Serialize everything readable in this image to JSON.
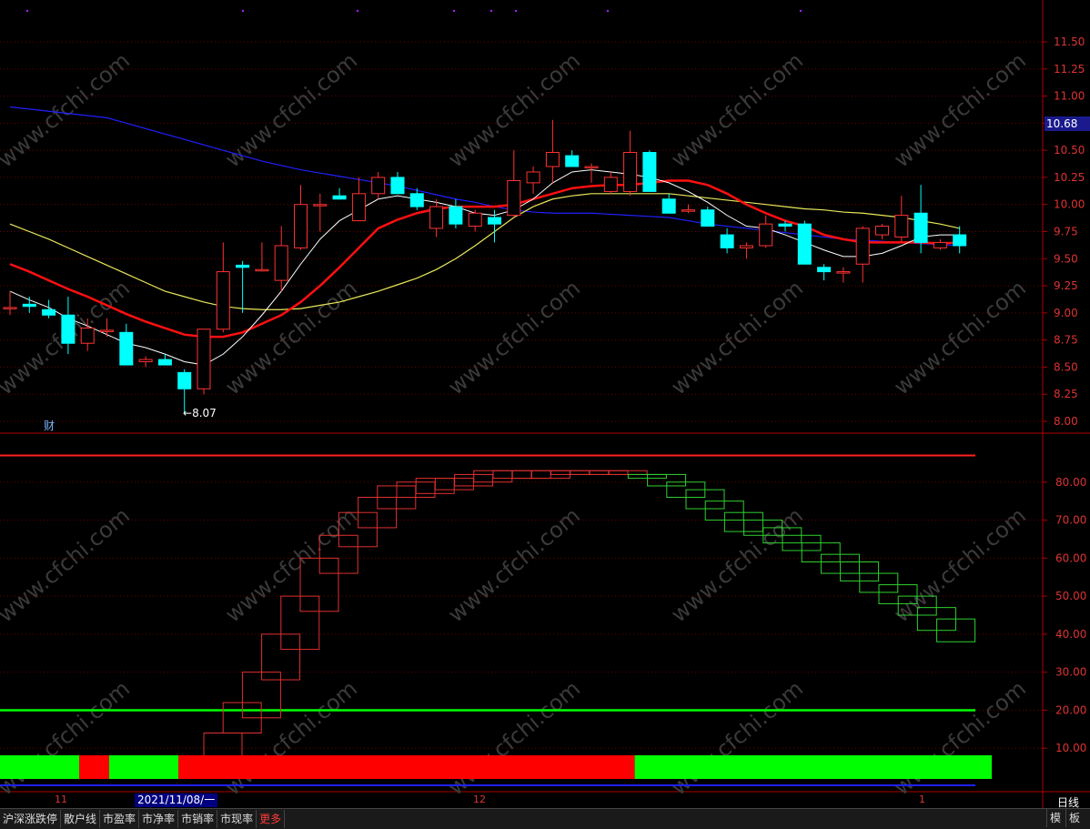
{
  "chart_data": [
    {
      "type": "candlestick",
      "y_ticks": [
        "11.50",
        "11.25",
        "11.00",
        "10.75",
        "10.50",
        "10.25",
        "10.00",
        "9.75",
        "9.50",
        "9.25",
        "9.00",
        "8.75",
        "8.50",
        "8.25",
        "8.00"
      ],
      "ylim": [
        8.0,
        11.5
      ],
      "current_price": "10.68",
      "low_annotation": "8.07",
      "finance_marker": "财",
      "candles": [
        {
          "o": 9.05,
          "h": 9.2,
          "l": 8.98,
          "c": 9.05
        },
        {
          "o": 9.08,
          "h": 9.15,
          "l": 9.0,
          "c": 9.06
        },
        {
          "o": 9.03,
          "h": 9.12,
          "l": 8.95,
          "c": 8.98
        },
        {
          "o": 8.98,
          "h": 9.15,
          "l": 8.62,
          "c": 8.72
        },
        {
          "o": 8.72,
          "h": 8.95,
          "l": 8.65,
          "c": 8.86
        },
        {
          "o": 8.84,
          "h": 8.95,
          "l": 8.78,
          "c": 8.84
        },
        {
          "o": 8.82,
          "h": 8.9,
          "l": 8.52,
          "c": 8.52
        },
        {
          "o": 8.55,
          "h": 8.6,
          "l": 8.5,
          "c": 8.57
        },
        {
          "o": 8.57,
          "h": 8.62,
          "l": 8.52,
          "c": 8.52
        },
        {
          "o": 8.45,
          "h": 8.48,
          "l": 8.07,
          "c": 8.3
        },
        {
          "o": 8.3,
          "h": 8.85,
          "l": 8.25,
          "c": 8.85
        },
        {
          "o": 8.85,
          "h": 9.65,
          "l": 8.82,
          "c": 9.38
        },
        {
          "o": 9.44,
          "h": 9.48,
          "l": 9.0,
          "c": 9.42
        },
        {
          "o": 9.4,
          "h": 9.65,
          "l": 9.38,
          "c": 9.4
        },
        {
          "o": 9.3,
          "h": 9.8,
          "l": 9.2,
          "c": 9.62
        },
        {
          "o": 9.6,
          "h": 10.18,
          "l": 9.58,
          "c": 10.0
        },
        {
          "o": 10.0,
          "h": 10.1,
          "l": 9.75,
          "c": 10.0
        },
        {
          "o": 10.08,
          "h": 10.15,
          "l": 10.05,
          "c": 10.05
        },
        {
          "o": 9.85,
          "h": 10.25,
          "l": 9.85,
          "c": 10.1
        },
        {
          "o": 10.1,
          "h": 10.3,
          "l": 10.05,
          "c": 10.25
        },
        {
          "o": 10.25,
          "h": 10.3,
          "l": 10.1,
          "c": 10.1
        },
        {
          "o": 10.1,
          "h": 10.15,
          "l": 9.95,
          "c": 9.98
        },
        {
          "o": 9.78,
          "h": 10.05,
          "l": 9.7,
          "c": 9.98
        },
        {
          "o": 9.98,
          "h": 10.05,
          "l": 9.78,
          "c": 9.82
        },
        {
          "o": 9.8,
          "h": 9.95,
          "l": 9.75,
          "c": 9.92
        },
        {
          "o": 9.88,
          "h": 9.95,
          "l": 9.65,
          "c": 9.82
        },
        {
          "o": 9.9,
          "h": 10.5,
          "l": 9.88,
          "c": 10.22
        },
        {
          "o": 10.2,
          "h": 10.35,
          "l": 10.1,
          "c": 10.3
        },
        {
          "o": 10.35,
          "h": 10.78,
          "l": 10.2,
          "c": 10.48
        },
        {
          "o": 10.45,
          "h": 10.5,
          "l": 10.35,
          "c": 10.35
        },
        {
          "o": 10.35,
          "h": 10.38,
          "l": 10.2,
          "c": 10.35
        },
        {
          "o": 10.12,
          "h": 10.3,
          "l": 10.1,
          "c": 10.25
        },
        {
          "o": 10.12,
          "h": 10.68,
          "l": 10.08,
          "c": 10.48
        },
        {
          "o": 10.48,
          "h": 10.5,
          "l": 10.12,
          "c": 10.12
        },
        {
          "o": 10.05,
          "h": 10.1,
          "l": 9.92,
          "c": 9.92
        },
        {
          "o": 9.95,
          "h": 10.0,
          "l": 9.92,
          "c": 9.95
        },
        {
          "o": 9.95,
          "h": 9.98,
          "l": 9.8,
          "c": 9.8
        },
        {
          "o": 9.72,
          "h": 9.78,
          "l": 9.55,
          "c": 9.6
        },
        {
          "o": 9.6,
          "h": 9.65,
          "l": 9.5,
          "c": 9.62
        },
        {
          "o": 9.62,
          "h": 9.9,
          "l": 9.6,
          "c": 9.82
        },
        {
          "o": 9.82,
          "h": 9.85,
          "l": 9.75,
          "c": 9.8
        },
        {
          "o": 9.82,
          "h": 9.85,
          "l": 9.45,
          "c": 9.45
        },
        {
          "o": 9.42,
          "h": 9.45,
          "l": 9.3,
          "c": 9.38
        },
        {
          "o": 9.38,
          "h": 9.42,
          "l": 9.28,
          "c": 9.38
        },
        {
          "o": 9.45,
          "h": 9.8,
          "l": 9.28,
          "c": 9.78
        },
        {
          "o": 9.72,
          "h": 9.82,
          "l": 9.68,
          "c": 9.8
        },
        {
          "o": 9.7,
          "h": 10.08,
          "l": 9.65,
          "c": 9.9
        },
        {
          "o": 9.92,
          "h": 10.18,
          "l": 9.55,
          "c": 9.65
        },
        {
          "o": 9.6,
          "h": 9.68,
          "l": 9.58,
          "c": 9.65
        },
        {
          "o": 9.72,
          "h": 9.8,
          "l": 9.55,
          "c": 9.62
        }
      ],
      "ma_white": [
        9.2,
        9.12,
        9.05,
        8.95,
        8.88,
        8.8,
        8.72,
        8.68,
        8.62,
        8.55,
        8.52,
        8.62,
        8.78,
        8.98,
        9.2,
        9.45,
        9.68,
        9.85,
        9.95,
        10.05,
        10.08,
        10.05,
        10.02,
        9.98,
        9.92,
        9.9,
        9.95,
        10.05,
        10.2,
        10.3,
        10.32,
        10.3,
        10.28,
        10.25,
        10.2,
        10.12,
        10.02,
        9.9,
        9.8,
        9.78,
        9.72,
        9.65,
        9.58,
        9.52,
        9.52,
        9.55,
        9.62,
        9.7,
        9.72,
        9.72
      ],
      "ma_red": [
        9.45,
        9.38,
        9.3,
        9.22,
        9.15,
        9.07,
        8.99,
        8.92,
        8.86,
        8.8,
        8.78,
        8.78,
        8.82,
        8.9,
        8.98,
        9.1,
        9.25,
        9.42,
        9.6,
        9.78,
        9.86,
        9.92,
        9.96,
        9.98,
        9.98,
        9.98,
        10.0,
        10.05,
        10.1,
        10.15,
        10.17,
        10.18,
        10.18,
        10.2,
        10.22,
        10.22,
        10.18,
        10.1,
        10.0,
        9.92,
        9.85,
        9.8,
        9.72,
        9.68,
        9.65,
        9.65,
        9.65,
        9.65,
        9.64,
        9.65
      ],
      "ma_yellow": [
        9.82,
        9.75,
        9.68,
        9.6,
        9.52,
        9.44,
        9.36,
        9.28,
        9.2,
        9.15,
        9.1,
        9.06,
        9.04,
        9.03,
        9.03,
        9.04,
        9.07,
        9.1,
        9.15,
        9.2,
        9.26,
        9.32,
        9.4,
        9.5,
        9.62,
        9.75,
        9.88,
        9.98,
        10.05,
        10.08,
        10.1,
        10.1,
        10.1,
        10.1,
        10.1,
        10.08,
        10.06,
        10.04,
        10.02,
        10.0,
        9.98,
        9.96,
        9.95,
        9.93,
        9.92,
        9.9,
        9.88,
        9.85,
        9.82,
        9.78
      ],
      "ma_blue": [
        10.9,
        10.88,
        10.86,
        10.84,
        10.82,
        10.8,
        10.75,
        10.7,
        10.65,
        10.6,
        10.55,
        10.5,
        10.45,
        10.4,
        10.36,
        10.32,
        10.29,
        10.26,
        10.23,
        10.2,
        10.17,
        10.13,
        10.09,
        10.05,
        10.02,
        9.98,
        9.95,
        9.93,
        9.92,
        9.92,
        9.92,
        9.91,
        9.9,
        9.89,
        9.88,
        9.85,
        9.82,
        9.8,
        9.78,
        9.76,
        9.74,
        9.72,
        9.7,
        9.68,
        9.67,
        9.66,
        9.65,
        9.64,
        9.63,
        9.62
      ]
    },
    {
      "type": "box-indicator",
      "y_ticks": [
        "80.00",
        "70.00",
        "60.00",
        "50.00",
        "40.00",
        "30.00",
        "20.00",
        "10.00"
      ],
      "ylim": [
        0,
        90
      ],
      "upper_line": 87,
      "lower_line": 20,
      "boxes": [
        {
          "lo": 8,
          "hi": 14,
          "up": true
        },
        {
          "lo": 14,
          "hi": 22,
          "up": true
        },
        {
          "lo": 18,
          "hi": 30,
          "up": true
        },
        {
          "lo": 28,
          "hi": 40,
          "up": true
        },
        {
          "lo": 36,
          "hi": 50,
          "up": true
        },
        {
          "lo": 46,
          "hi": 60,
          "up": true
        },
        {
          "lo": 56,
          "hi": 66,
          "up": true
        },
        {
          "lo": 63,
          "hi": 72,
          "up": true
        },
        {
          "lo": 68,
          "hi": 76,
          "up": true
        },
        {
          "lo": 73,
          "hi": 79,
          "up": true
        },
        {
          "lo": 76,
          "hi": 80,
          "up": true
        },
        {
          "lo": 77,
          "hi": 81,
          "up": true
        },
        {
          "lo": 78,
          "hi": 81,
          "up": true
        },
        {
          "lo": 79,
          "hi": 82,
          "up": true
        },
        {
          "lo": 80,
          "hi": 83,
          "up": true
        },
        {
          "lo": 81,
          "hi": 83,
          "up": true
        },
        {
          "lo": 81,
          "hi": 83,
          "up": true
        },
        {
          "lo": 81,
          "hi": 83,
          "up": true
        },
        {
          "lo": 82,
          "hi": 83,
          "up": true
        },
        {
          "lo": 82,
          "hi": 83,
          "up": true
        },
        {
          "lo": 82,
          "hi": 83,
          "up": true
        },
        {
          "lo": 82,
          "hi": 83,
          "up": true
        },
        {
          "lo": 81,
          "hi": 82,
          "up": false
        },
        {
          "lo": 79,
          "hi": 82,
          "up": false
        },
        {
          "lo": 76,
          "hi": 80,
          "up": false
        },
        {
          "lo": 73,
          "hi": 78,
          "up": false
        },
        {
          "lo": 70,
          "hi": 75,
          "up": false
        },
        {
          "lo": 67,
          "hi": 72,
          "up": false
        },
        {
          "lo": 66,
          "hi": 70,
          "up": false
        },
        {
          "lo": 64,
          "hi": 68,
          "up": false
        },
        {
          "lo": 62,
          "hi": 66,
          "up": false
        },
        {
          "lo": 59,
          "hi": 64,
          "up": false
        },
        {
          "lo": 56,
          "hi": 61,
          "up": false
        },
        {
          "lo": 54,
          "hi": 59,
          "up": false
        },
        {
          "lo": 51,
          "hi": 56,
          "up": false
        },
        {
          "lo": 48,
          "hi": 53,
          "up": false
        },
        {
          "lo": 45,
          "hi": 50,
          "up": false
        },
        {
          "lo": 41,
          "hi": 47,
          "up": false
        },
        {
          "lo": 38,
          "hi": 44,
          "up": false
        }
      ],
      "bands": [
        {
          "from": 0,
          "to": 4,
          "color": "#00ff00"
        },
        {
          "from": 4,
          "to": 5.5,
          "color": "#ff0000"
        },
        {
          "from": 5.5,
          "to": 9,
          "color": "#00ff00"
        },
        {
          "from": 9,
          "to": 32,
          "color": "#ff0000"
        },
        {
          "from": 32,
          "to": 50,
          "color": "#00ff00"
        }
      ]
    }
  ],
  "x_axis": {
    "months": [
      "11",
      "12",
      "1"
    ],
    "cursor_date": "2021/11/08/一",
    "period": "日线"
  },
  "watermark": "www.cfchi.com",
  "colors": {
    "up": "#ff3232",
    "down": "#00ffff",
    "ma_white": "#ffffff",
    "ma_red": "#ff1010",
    "ma_yellow": "#e8e85a",
    "ma_blue": "#2020ff"
  },
  "bottom_tabs": [
    "沪深涨跌停",
    "散户线",
    "市盈率",
    "市净率",
    "市销率",
    "市现率",
    "更多"
  ],
  "bottom_right": [
    "模",
    "板"
  ]
}
